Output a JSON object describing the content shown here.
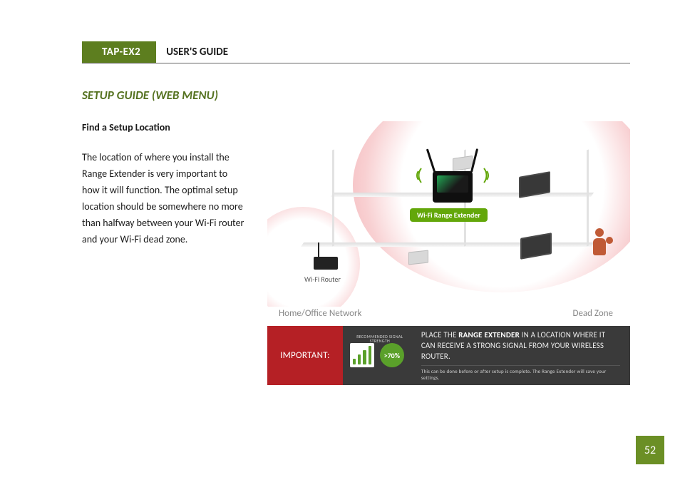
{
  "header": {
    "product_code": "TAP-EX2",
    "doc_title": "USER'S GUIDE"
  },
  "section_title": "SETUP GUIDE (WEB MENU)",
  "subsection_title": "Find a Setup Location",
  "body_paragraph": "The location of where you install the Range Extender is very important to how it will function. The optimal setup location should be somewhere no more than halfway between your Wi-Fi router and your Wi-Fi dead zone.",
  "illustration": {
    "device_label": "Wi-Fi Range Extender",
    "router_label": "Wi-Fi Router",
    "left_caption": "Home/Office Network",
    "right_caption": "Dead Zone"
  },
  "banner": {
    "important_label": "IMPORTANT:",
    "recommended_label": "RECOMMENDED SIGNAL STRENGTH",
    "percent_badge": ">70%",
    "main_pre": "PLACE THE ",
    "main_bold": "RANGE EXTENDER",
    "main_post": " IN A LOCATION WHERE IT CAN RECEIVE A STRONG SIGNAL FROM YOUR WIRELESS ROUTER.",
    "sub_text": "This can be done before or after setup is complete. The Range Extender will save your settings."
  },
  "page_number": "52"
}
